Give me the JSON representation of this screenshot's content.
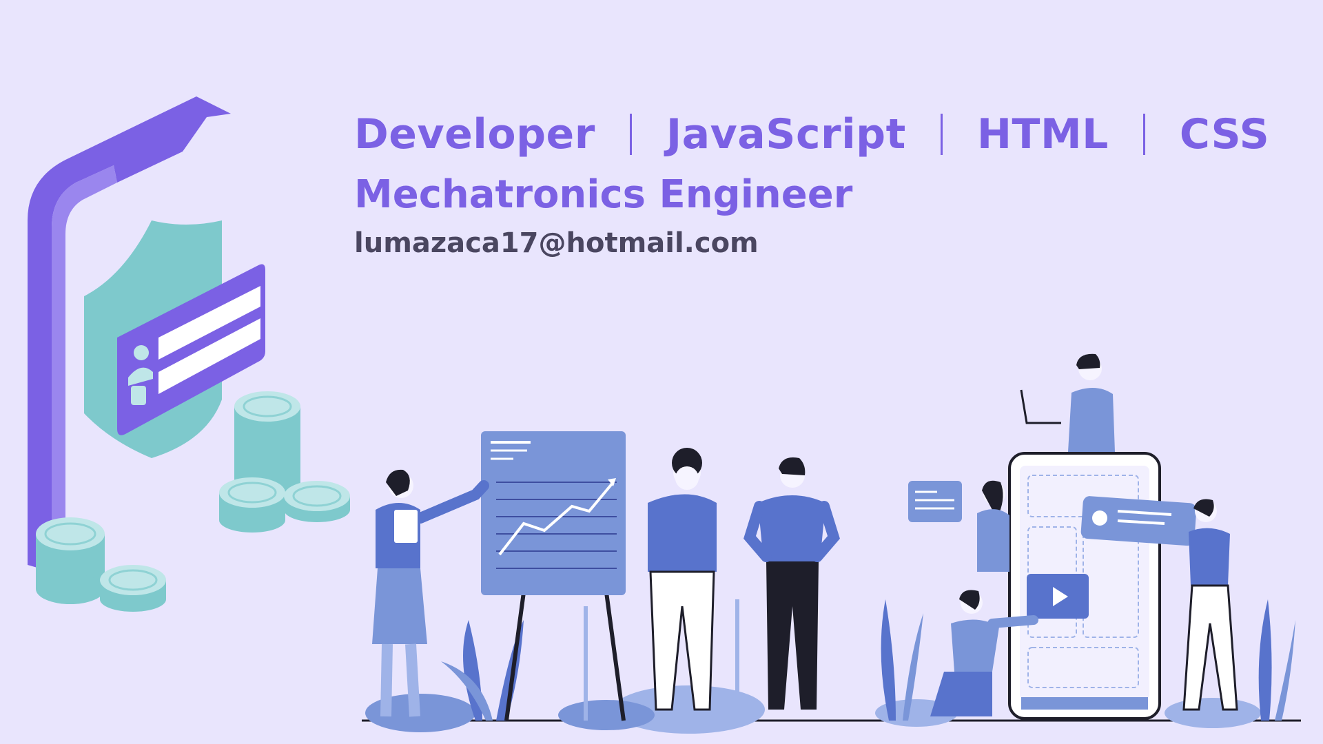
{
  "skills": [
    {
      "label": "Developer"
    },
    {
      "label": "JavaScript"
    },
    {
      "label": "HTML"
    },
    {
      "label": "CSS"
    }
  ],
  "subtitle": "Mechatronics Engineer",
  "email": "lumazaca17@hotmail.com",
  "colors": {
    "background": "#e9e5fd",
    "accent": "#7b61e4",
    "teal": "#7ec9cc",
    "blue": "#5873cc",
    "text_dark": "#4a4660"
  },
  "illustrations": [
    "phone-security-icon",
    "shield-icon",
    "id-card-icon",
    "coin-stack-icon",
    "presentation-team-illustration",
    "mobile-app-team-illustration"
  ]
}
